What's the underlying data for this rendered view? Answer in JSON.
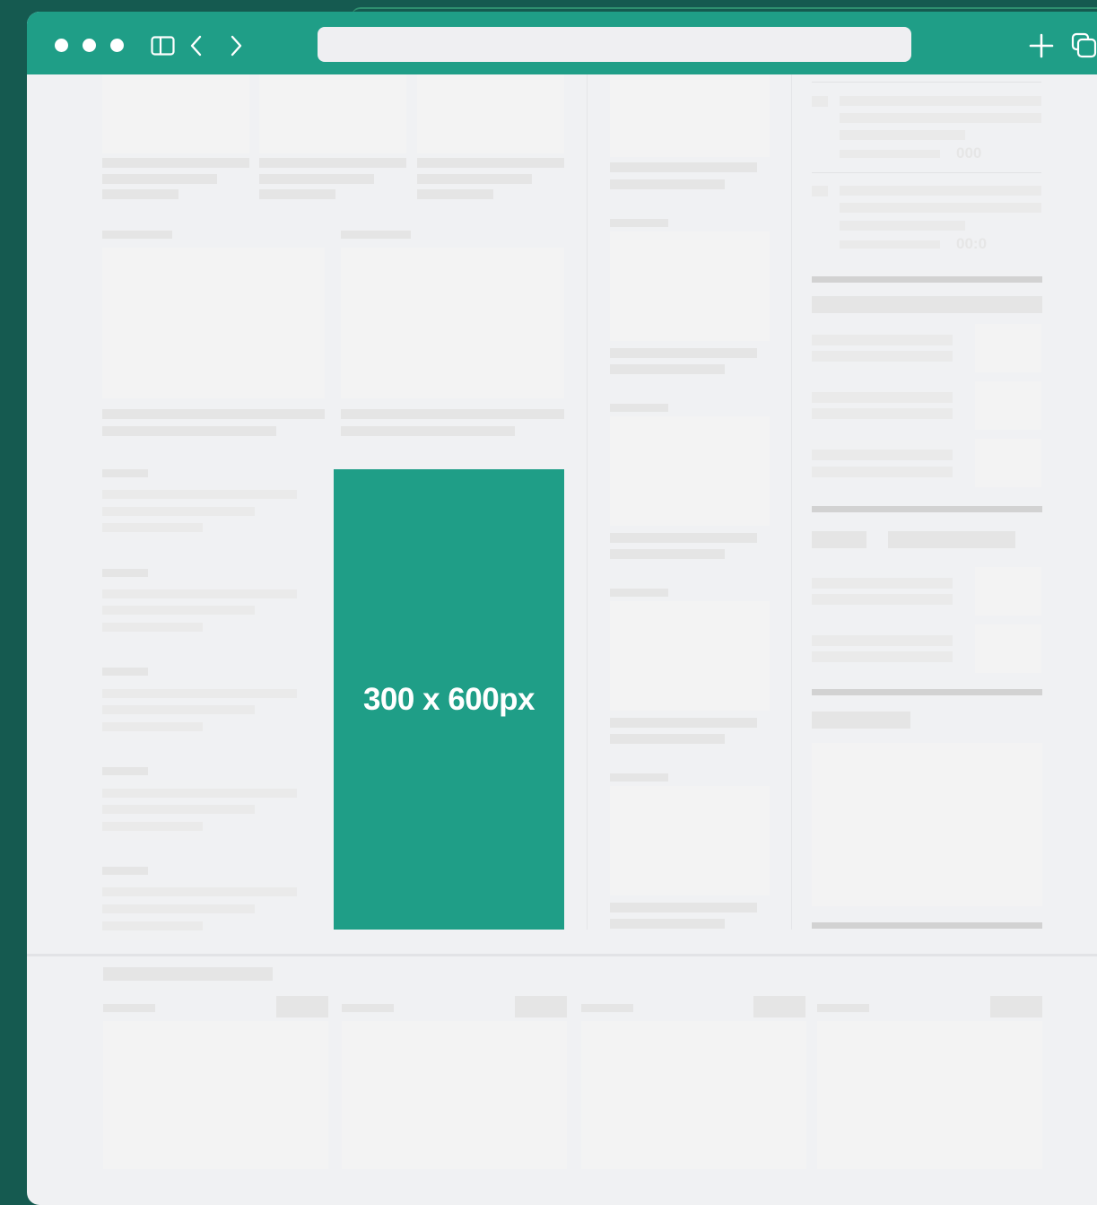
{
  "browser": {
    "window_controls": [
      "close",
      "minimize",
      "zoom"
    ],
    "toolbar_icons": [
      "sidebar-toggle-icon",
      "back-icon",
      "forward-icon",
      "new-tab-icon",
      "tab-overview-icon"
    ],
    "address_bar": {
      "value": ""
    },
    "accent_color": "#1F9E87",
    "background_color": "#155A50"
  },
  "ad_slot": {
    "label": "300 x 600px",
    "color": "#1F9E87"
  },
  "sidebar_counts": [
    "000",
    "00:0"
  ]
}
